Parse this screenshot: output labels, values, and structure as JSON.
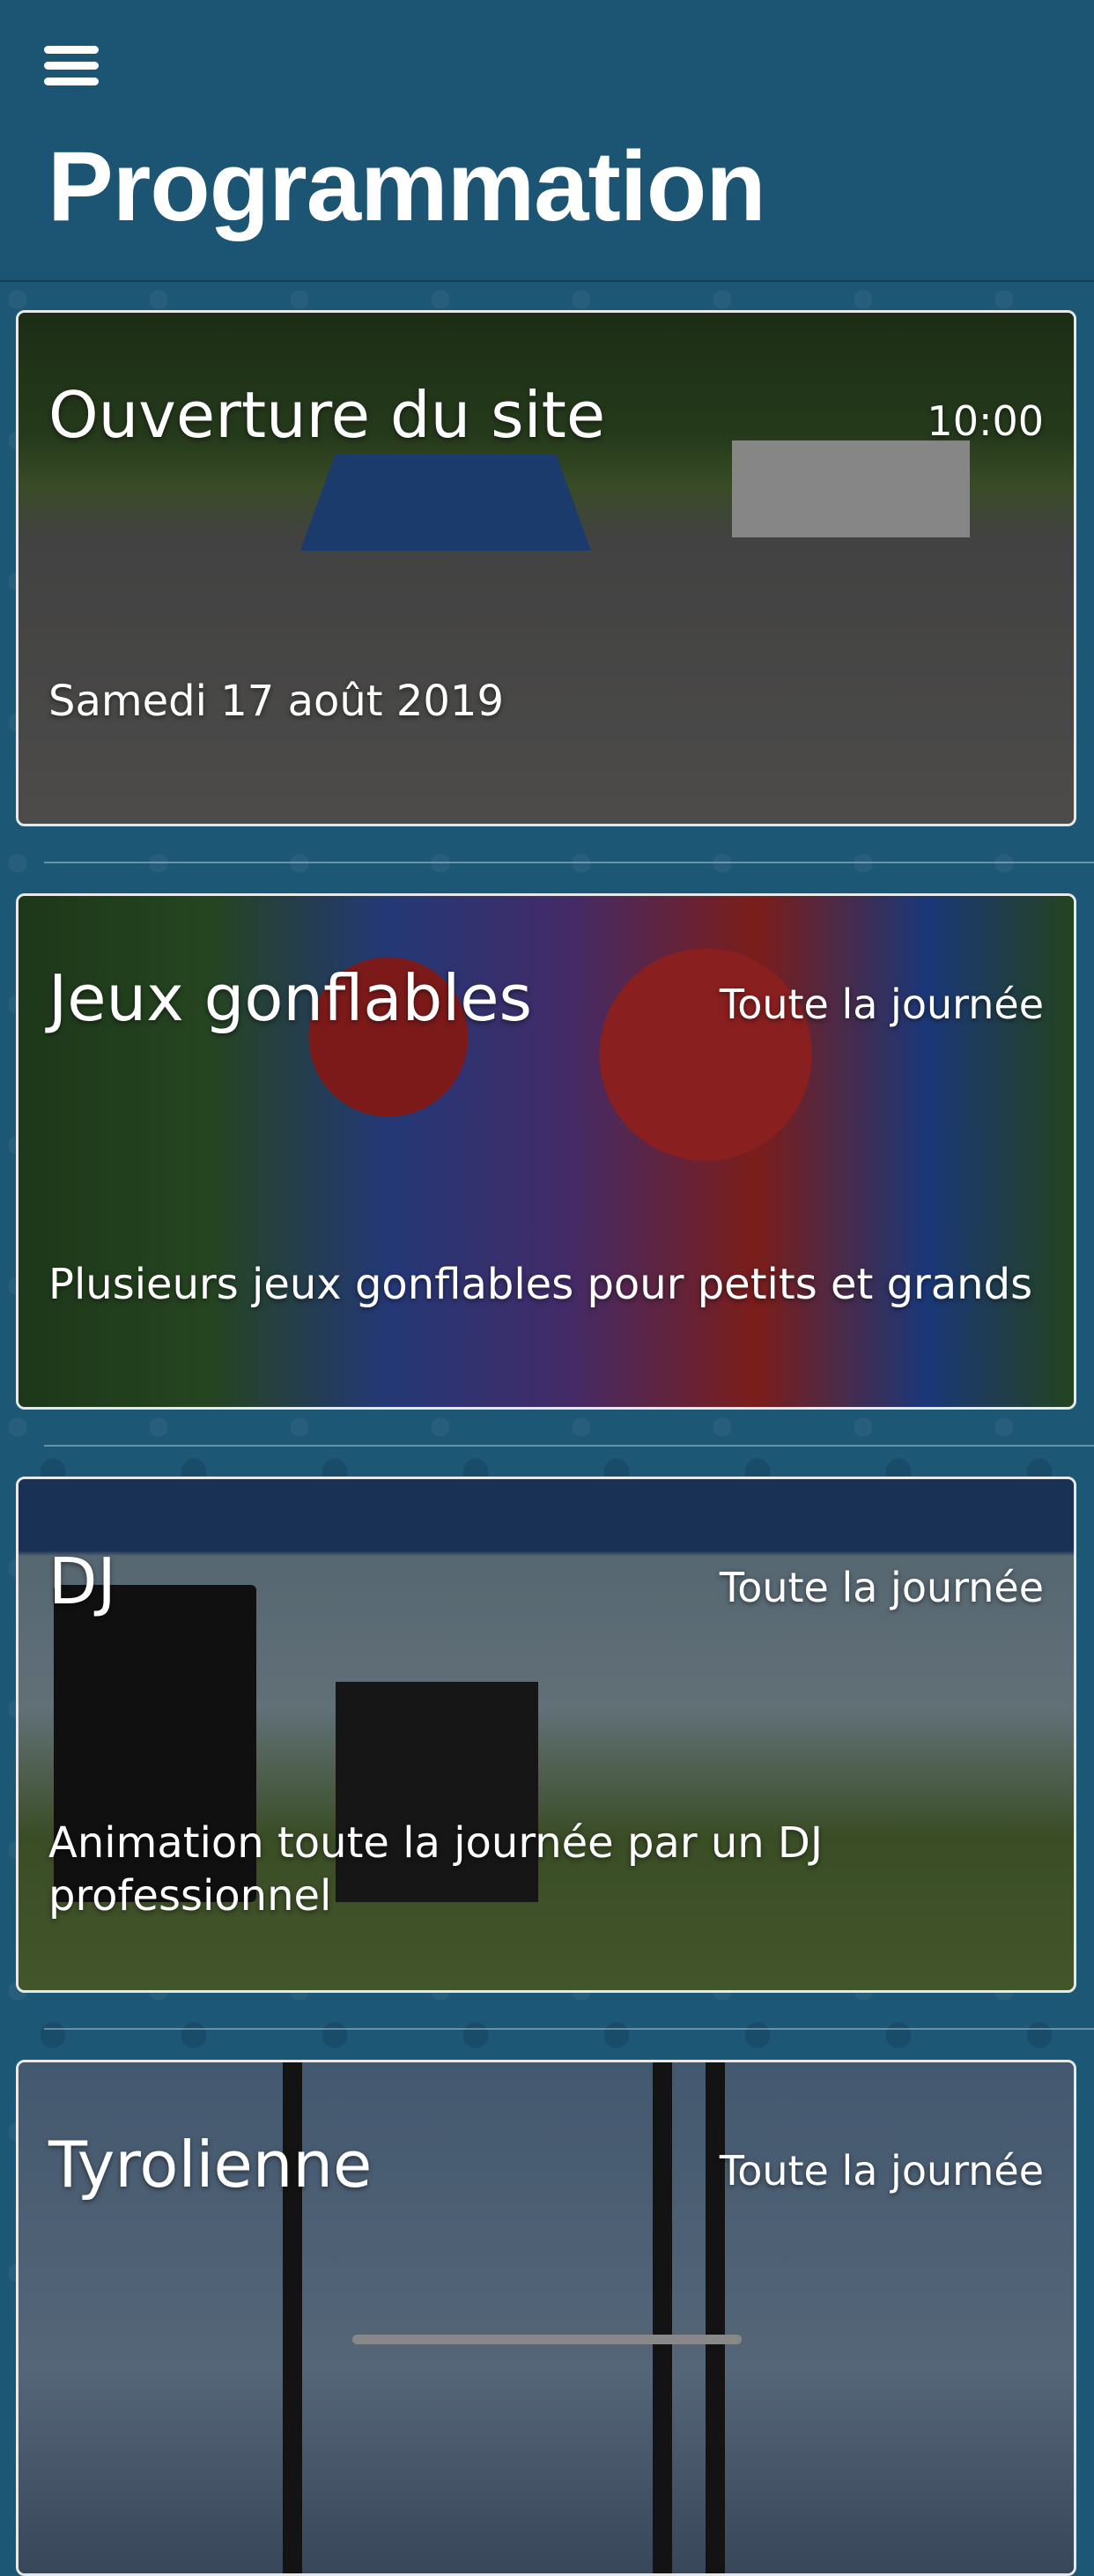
{
  "header": {
    "title": "Programmation",
    "menu_icon": "hamburger-menu-icon"
  },
  "events": [
    {
      "title": "Ouverture du site",
      "time": "10:00",
      "description": "Samedi 17 août 2019",
      "photo": "crowd-festival-photo"
    },
    {
      "title": "Jeux gonflables",
      "time": "Toute la journée",
      "description": "Plusieurs jeux gonflables pour petits et grands",
      "photo": "inflatable-games-photo"
    },
    {
      "title": "DJ",
      "time": "Toute la journée",
      "description": "Animation toute la journée par un DJ professionnel",
      "photo": "dj-booth-photo"
    },
    {
      "title": "Tyrolienne",
      "time": "Toute la journée",
      "description": "",
      "photo": "zipline-photo"
    }
  ],
  "colors": {
    "background": "#1d5776",
    "text": "#ffffff",
    "card_border": "#e8e8e8"
  }
}
